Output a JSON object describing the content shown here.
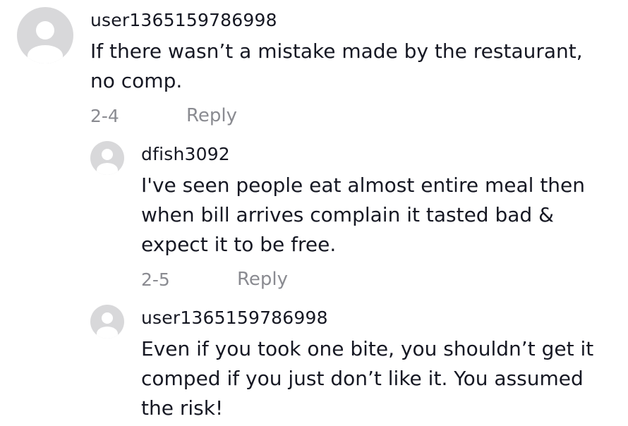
{
  "comments": [
    {
      "username": "user1365159786998",
      "text": "If there wasn’t a mistake made by the restaurant, no comp.",
      "date": "2-4",
      "reply_label": "Reply"
    },
    {
      "username": "dfish3092",
      "text": "I've seen people eat almost entire meal then when bill arrives complain it tasted bad & expect it to be free.",
      "date": "2-5",
      "reply_label": "Reply"
    },
    {
      "username": "user1365159786998",
      "text": "Even if you took one bite, you shouldn’t get it comped if you just don’t like it. You assumed the risk!"
    }
  ]
}
